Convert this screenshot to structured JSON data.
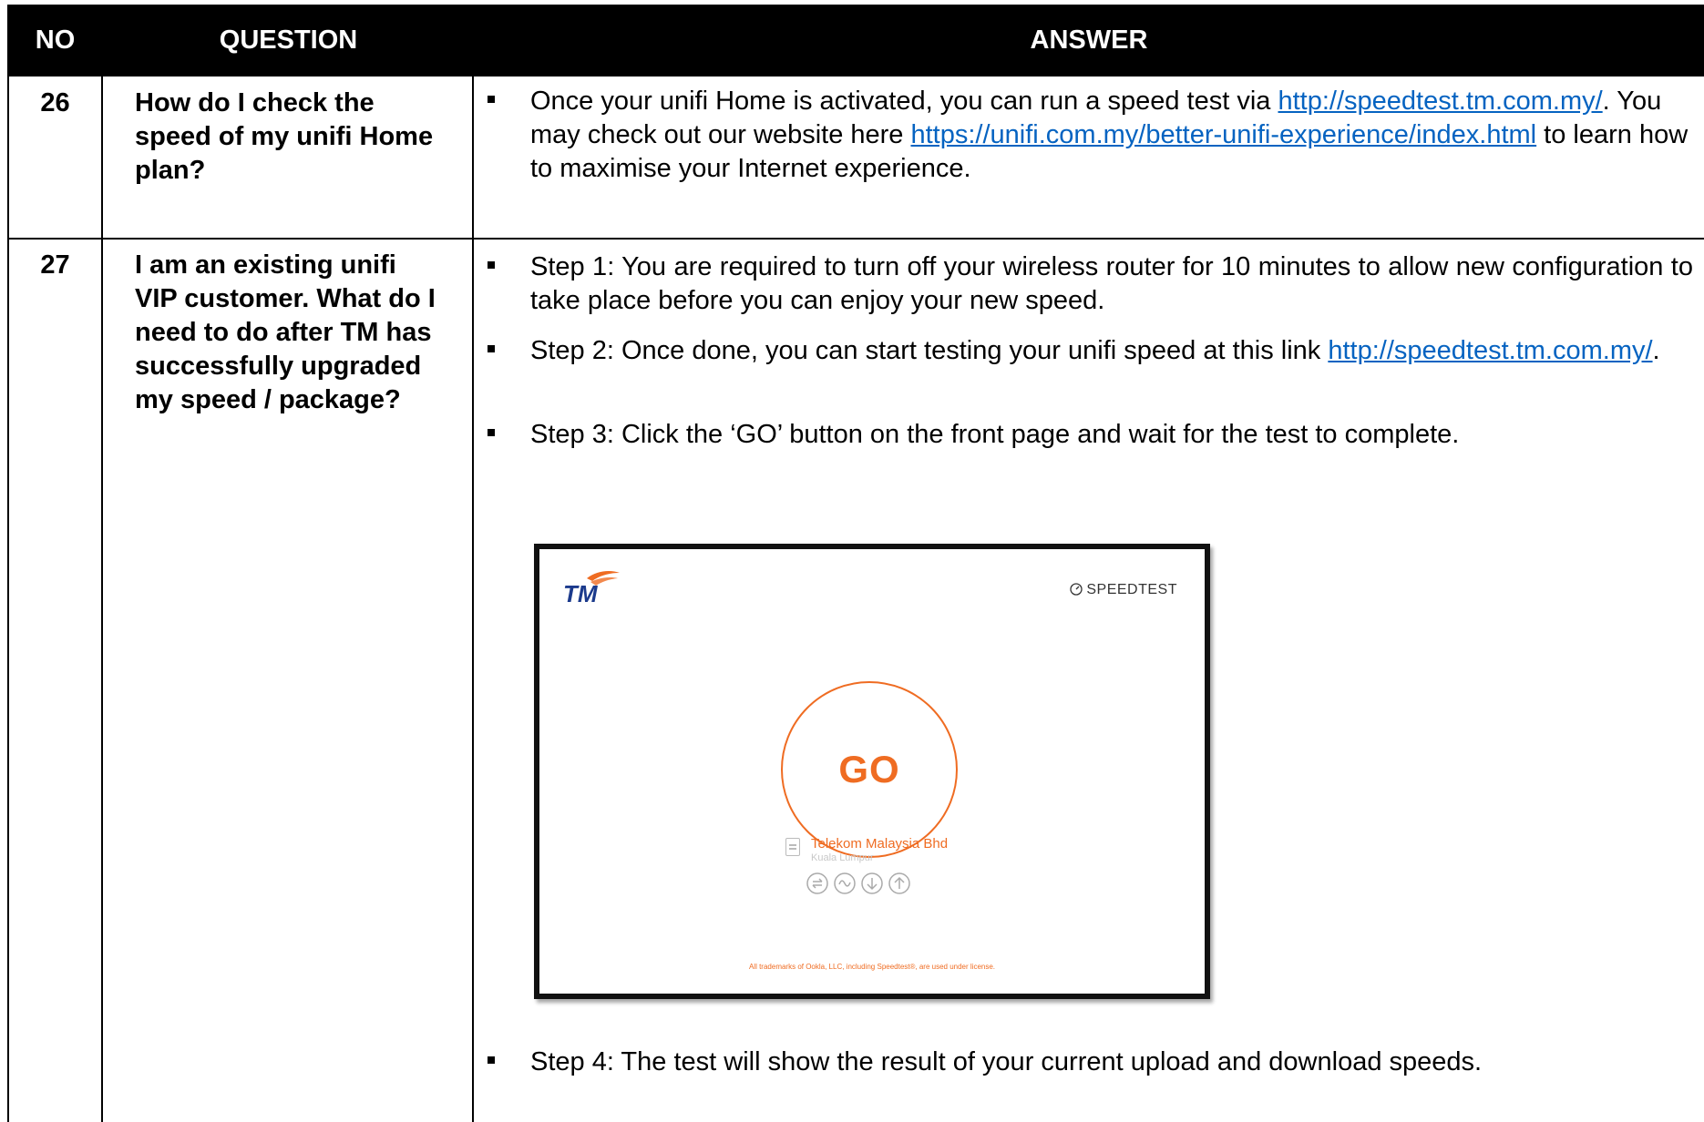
{
  "header": {
    "no": "NO",
    "question": "QUESTION",
    "answer": "ANSWER"
  },
  "rows": [
    {
      "no": "26",
      "question": "How do I check the speed of my unifi Home plan?",
      "answer": {
        "t1": "Once your unifi Home is activated, you can run a speed test via ",
        "link1": "http://speedtest.tm.com.my/",
        "t2": ". You may check out our website here ",
        "link2": "https://unifi.com.my/better-unifi-experience/index.html",
        "t3": " to learn how to maximise your Internet experience."
      }
    },
    {
      "no": "27",
      "question": "I am an existing unifi VIP customer. What do I need to do after TM has successfully upgraded my speed / package?",
      "steps": {
        "s1": "Step 1: You are required to turn off your wireless router for 10 minutes to allow new configuration to take place before you can enjoy your new speed.",
        "s2_text": "Step 2: Once done, you can start testing your unifi speed at this link ",
        "s2_link": "http://speedtest.tm.com.my/",
        "s2_end": ".",
        "s3": "Step 3: Click the ‘GO’ button on the front page and wait for the test to complete.",
        "s4": "Step 4: The test will show the result of your current upload and download speeds."
      }
    }
  ],
  "speedtest_image": {
    "logo_text": "TM",
    "brand_label": "SPEEDTEST",
    "go_label": "GO",
    "isp_name": "Telekom Malaysia Bhd",
    "isp_location": "Kuala Lumpur",
    "trademark_note": "All trademarks of Ookla, LLC, including Speedtest®, are used under license.",
    "accent_color": "#ef6c22",
    "icons": [
      "connections-icon",
      "ping-icon",
      "download-icon",
      "upload-icon"
    ]
  }
}
